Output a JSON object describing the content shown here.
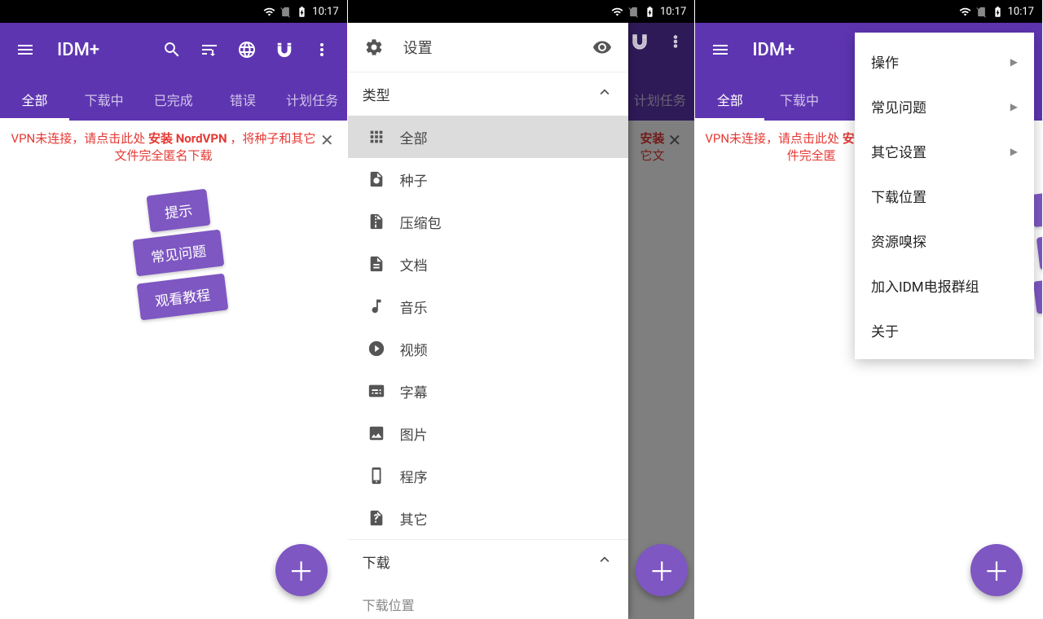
{
  "status": {
    "time": "10:17"
  },
  "app": {
    "title": "IDM+"
  },
  "tabs": [
    {
      "label": "全部",
      "active": true
    },
    {
      "label": "下载中",
      "active": false
    },
    {
      "label": "已完成",
      "active": false
    },
    {
      "label": "错误",
      "active": false
    },
    {
      "label": "计划任务",
      "active": false
    }
  ],
  "banner": {
    "pre": "VPN未连接，请点击此处 ",
    "bold": "安装 NordVPN",
    "post": " ，将种子和其它文件完全匿名下载"
  },
  "hints": {
    "tip": "提示",
    "faq": "常见问题",
    "tutorial": "观看教程"
  },
  "drawer": {
    "title": "设置",
    "section_type": "类型",
    "section_download": "下载",
    "download_location": "下载位置",
    "cats": [
      {
        "label": "全部"
      },
      {
        "label": "种子"
      },
      {
        "label": "压缩包"
      },
      {
        "label": "文档"
      },
      {
        "label": "音乐"
      },
      {
        "label": "视频"
      },
      {
        "label": "字幕"
      },
      {
        "label": "图片"
      },
      {
        "label": "程序"
      },
      {
        "label": "其它"
      }
    ]
  },
  "popup": {
    "items": [
      {
        "label": "操作",
        "arrow": true
      },
      {
        "label": "常见问题",
        "arrow": true
      },
      {
        "label": "其它设置",
        "arrow": true
      },
      {
        "label": "下载位置",
        "arrow": false
      },
      {
        "label": "资源嗅探",
        "arrow": false
      },
      {
        "label": "加入IDM电报群组",
        "arrow": false
      },
      {
        "label": "关于",
        "arrow": false
      }
    ]
  },
  "obscured_tab": "计划任务",
  "obscured_banner1": "安装",
  "obscured_banner2": "它文",
  "obscured_banner3": "连接，请点击此处",
  "obscured_banner4": "件完全匿"
}
